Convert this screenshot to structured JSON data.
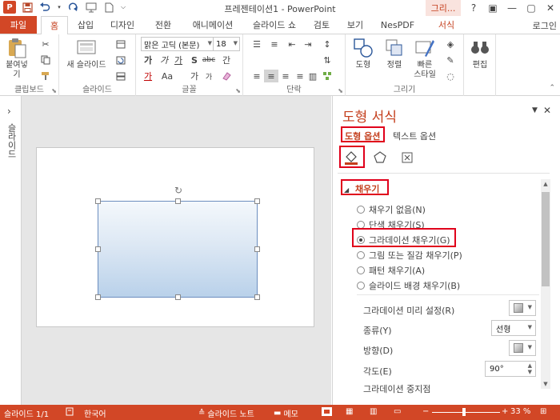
{
  "app": {
    "title": "프레젠테이션1 - PowerPoint",
    "context_tab_group": "그리...",
    "logo_letter": "P",
    "window_controls": [
      "?",
      "▣",
      "—",
      "▢",
      "✕"
    ]
  },
  "tabs": {
    "file": "파일",
    "home": "홈",
    "insert": "삽입",
    "design": "디자인",
    "transitions": "전환",
    "animations": "애니메이션",
    "slideshow": "슬라이드 쇼",
    "review": "검토",
    "view": "보기",
    "nespdf": "NesPDF",
    "format": "서식",
    "login": "로그인"
  },
  "ribbon": {
    "clipboard": {
      "label": "클립보드",
      "paste": "붙여넣기"
    },
    "slides": {
      "label": "슬라이드",
      "new_slide": "새 슬라이드"
    },
    "font": {
      "label": "글꼴",
      "font_name": "맑은 고딕 (본문)",
      "font_size": "18",
      "bold": "가",
      "italic": "가",
      "underline": "가",
      "strike": "S",
      "shadow": "abc",
      "spacing": "간",
      "font_color": "가",
      "case": "Aa",
      "grow": "가",
      "shrink": "가"
    },
    "paragraph": {
      "label": "단락"
    },
    "drawing": {
      "label": "그리기",
      "shapes": "도형",
      "arrange": "정렬",
      "quick_styles_1": "빠른",
      "quick_styles_2": "스타일"
    },
    "editing": {
      "label": "편집",
      "edit": "편집"
    }
  },
  "thumbnails": {
    "label": "슬라이드",
    "chevron": "›"
  },
  "pane": {
    "title": "도형 서식",
    "tab_shape_options": "도형 옵션",
    "tab_text_options": "텍스트 옵션",
    "fill_section": "채우기",
    "fill_options": [
      {
        "label": "채우기 없음(N)",
        "selected": false
      },
      {
        "label": "단색 채우기(S)",
        "selected": false
      },
      {
        "label": "그라데이션 채우기(G)",
        "selected": true
      },
      {
        "label": "그림 또는 질감 채우기(P)",
        "selected": false
      },
      {
        "label": "패턴 채우기(A)",
        "selected": false
      },
      {
        "label": "슬라이드 배경 채우기(B)",
        "selected": false
      }
    ],
    "preset_label": "그라데이션 미리 설정(R)",
    "type_label": "종류(Y)",
    "type_value": "선형",
    "direction_label": "방향(D)",
    "angle_label": "각도(E)",
    "angle_value": "90°",
    "stops_label": "그라데이션 중지점"
  },
  "status": {
    "slide_count": "슬라이드 1/1",
    "language": "한국어",
    "notes": "슬라이드 노트",
    "comments": "메모",
    "zoom": "33 %",
    "zoom_percent": 33
  },
  "colors": {
    "accent": "#d24726",
    "accent_text": "#c43e1c",
    "highlight_box": "#e0001b"
  }
}
